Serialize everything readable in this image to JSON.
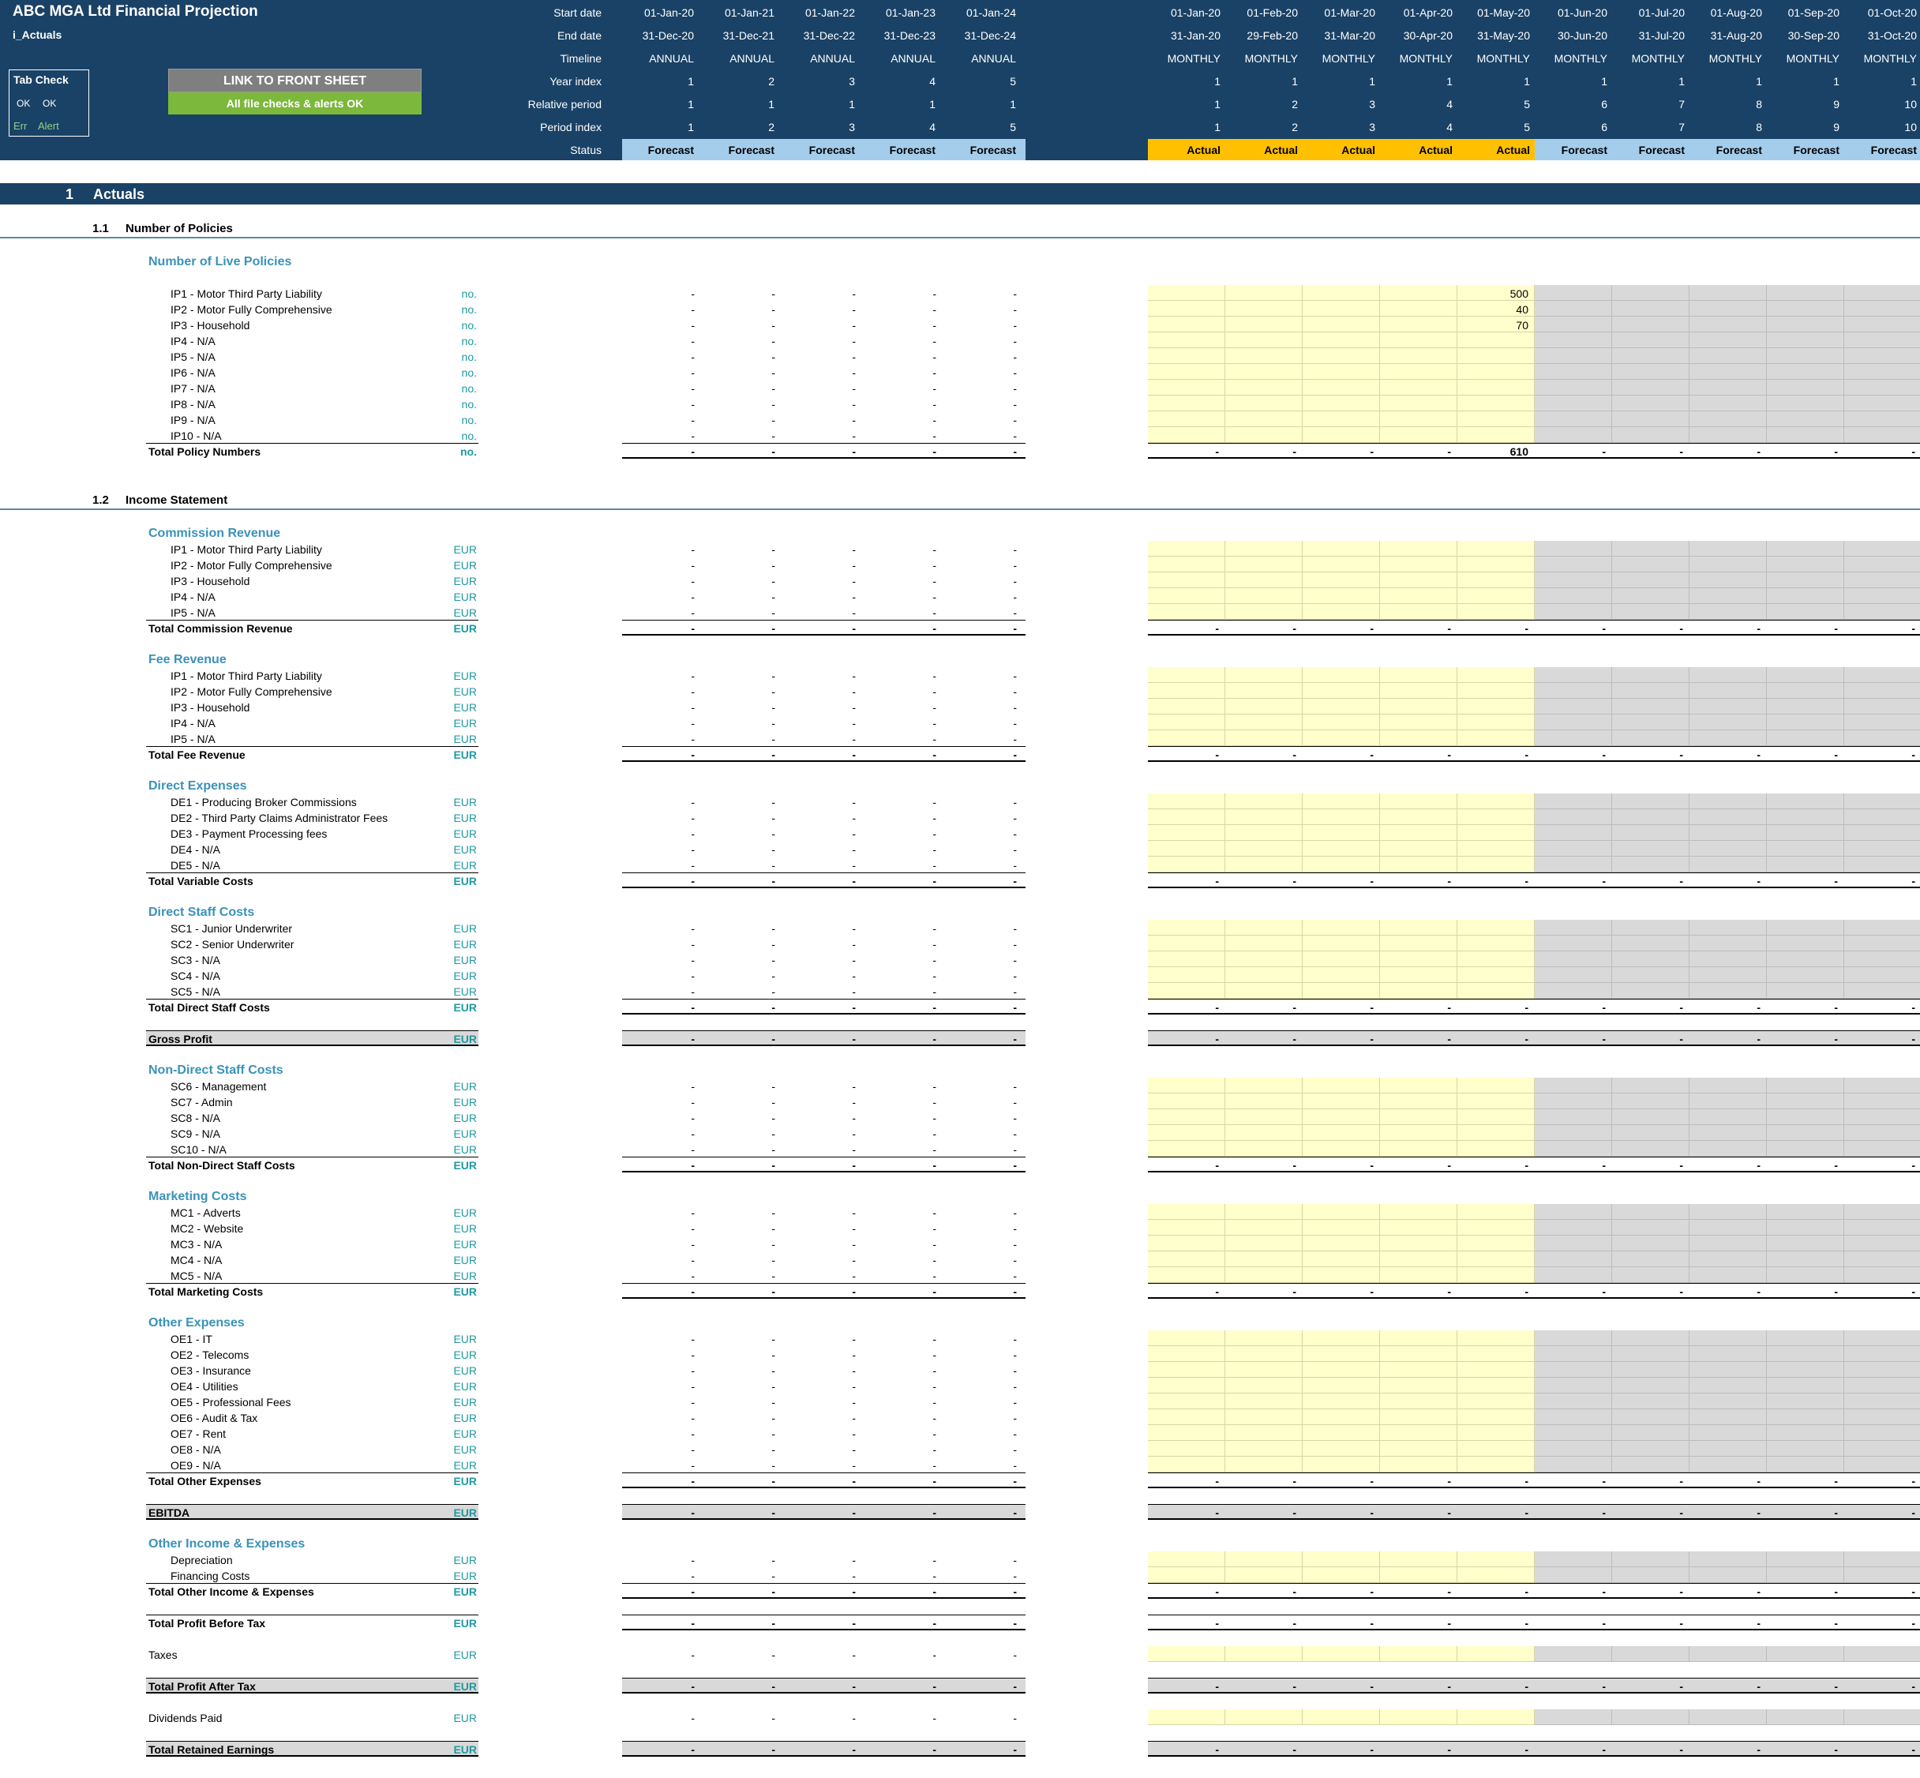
{
  "app": {
    "title": "ABC MGA Ltd Financial Projection",
    "sheet_name": "i_Actuals"
  },
  "tab_check": {
    "title": "Tab Check",
    "ok1": "OK",
    "ok2": "OK",
    "err": "Err",
    "alert": "Alert"
  },
  "buttons": {
    "link_front_sheet": "LINK TO FRONT SHEET",
    "file_checks": "All file checks & alerts OK"
  },
  "colors": {
    "header_navy": "#1a4266",
    "forecast_blue": "#a4cdec",
    "actual_orange": "#ffc000",
    "input_yellow": "#ffffcc",
    "locked_grey": "#d9d9d9",
    "teal_label": "#3a92b9",
    "unit_teal": "#1e9aa0",
    "green_button": "#7cb83b",
    "grey_button": "#7f7f7f"
  },
  "timeline": {
    "labels": [
      "Start date",
      "End date",
      "Timeline",
      "Year index",
      "Relative period",
      "Period index",
      "Status"
    ],
    "annual": {
      "start": [
        "01-Jan-20",
        "01-Jan-21",
        "01-Jan-22",
        "01-Jan-23",
        "01-Jan-24"
      ],
      "end": [
        "31-Dec-20",
        "31-Dec-21",
        "31-Dec-22",
        "31-Dec-23",
        "31-Dec-24"
      ],
      "timeline": [
        "ANNUAL",
        "ANNUAL",
        "ANNUAL",
        "ANNUAL",
        "ANNUAL"
      ],
      "year_index": [
        "1",
        "2",
        "3",
        "4",
        "5"
      ],
      "relative_period": [
        "1",
        "1",
        "1",
        "1",
        "1"
      ],
      "period_index": [
        "1",
        "2",
        "3",
        "4",
        "5"
      ],
      "status": [
        "Forecast",
        "Forecast",
        "Forecast",
        "Forecast",
        "Forecast"
      ]
    },
    "monthly": {
      "start": [
        "01-Jan-20",
        "01-Feb-20",
        "01-Mar-20",
        "01-Apr-20",
        "01-May-20",
        "01-Jun-20",
        "01-Jul-20",
        "01-Aug-20",
        "01-Sep-20",
        "01-Oct-20"
      ],
      "end": [
        "31-Jan-20",
        "29-Feb-20",
        "31-Mar-20",
        "30-Apr-20",
        "31-May-20",
        "30-Jun-20",
        "31-Jul-20",
        "31-Aug-20",
        "30-Sep-20",
        "31-Oct-20"
      ],
      "timeline": [
        "MONTHLY",
        "MONTHLY",
        "MONTHLY",
        "MONTHLY",
        "MONTHLY",
        "MONTHLY",
        "MONTHLY",
        "MONTHLY",
        "MONTHLY",
        "MONTHLY"
      ],
      "year_index": [
        "1",
        "1",
        "1",
        "1",
        "1",
        "1",
        "1",
        "1",
        "1",
        "1"
      ],
      "relative_period": [
        "1",
        "2",
        "3",
        "4",
        "5",
        "6",
        "7",
        "8",
        "9",
        "10"
      ],
      "period_index": [
        "1",
        "2",
        "3",
        "4",
        "5",
        "6",
        "7",
        "8",
        "9",
        "10"
      ],
      "status": [
        "Actual",
        "Actual",
        "Actual",
        "Actual",
        "Actual",
        "Forecast",
        "Forecast",
        "Forecast",
        "Forecast",
        "Forecast"
      ]
    }
  },
  "section": {
    "number": "1",
    "title": "Actuals"
  },
  "dash": "-",
  "blocks": [
    {
      "kind": "subsection",
      "number": "1.1",
      "title": "Number of Policies"
    },
    {
      "kind": "spacer"
    },
    {
      "kind": "group",
      "title": "Number of Live Policies"
    },
    {
      "kind": "spacer"
    },
    {
      "kind": "line",
      "label": "IP1 - Motor Third Party Liability",
      "unit": "no.",
      "monthly_values": [
        "",
        "",
        "",
        "",
        "500",
        "",
        "",
        "",
        "",
        ""
      ]
    },
    {
      "kind": "line",
      "label": "IP2 - Motor Fully Comprehensive",
      "unit": "no.",
      "monthly_values": [
        "",
        "",
        "",
        "",
        "40",
        "",
        "",
        "",
        "",
        ""
      ]
    },
    {
      "kind": "line",
      "label": "IP3 - Household",
      "unit": "no.",
      "monthly_values": [
        "",
        "",
        "",
        "",
        "70",
        "",
        "",
        "",
        "",
        ""
      ]
    },
    {
      "kind": "line",
      "label": "IP4 - N/A",
      "unit": "no."
    },
    {
      "kind": "line",
      "label": "IP5 - N/A",
      "unit": "no."
    },
    {
      "kind": "line",
      "label": "IP6 - N/A",
      "unit": "no."
    },
    {
      "kind": "line",
      "label": "IP7 - N/A",
      "unit": "no."
    },
    {
      "kind": "line",
      "label": "IP8 - N/A",
      "unit": "no."
    },
    {
      "kind": "line",
      "label": "IP9 - N/A",
      "unit": "no."
    },
    {
      "kind": "line",
      "label": "IP10 - N/A",
      "unit": "no."
    },
    {
      "kind": "total",
      "label": "Total Policy Numbers",
      "unit": "no.",
      "monthly_values": [
        "-",
        "-",
        "-",
        "-",
        "610",
        "-",
        "-",
        "-",
        "-",
        "-"
      ]
    },
    {
      "kind": "spacer"
    },
    {
      "kind": "spacer"
    },
    {
      "kind": "subsection",
      "number": "1.2",
      "title": "Income Statement"
    },
    {
      "kind": "spacer"
    },
    {
      "kind": "group",
      "title": "Commission Revenue"
    },
    {
      "kind": "line",
      "label": "IP1 - Motor Third Party Liability",
      "unit": "EUR"
    },
    {
      "kind": "line",
      "label": "IP2 - Motor Fully Comprehensive",
      "unit": "EUR"
    },
    {
      "kind": "line",
      "label": "IP3 - Household",
      "unit": "EUR"
    },
    {
      "kind": "line",
      "label": "IP4 - N/A",
      "unit": "EUR"
    },
    {
      "kind": "line",
      "label": "IP5 - N/A",
      "unit": "EUR"
    },
    {
      "kind": "total",
      "label": "Total Commission Revenue",
      "unit": "EUR"
    },
    {
      "kind": "spacer"
    },
    {
      "kind": "group",
      "title": "Fee Revenue"
    },
    {
      "kind": "line",
      "label": "IP1 - Motor Third Party Liability",
      "unit": "EUR"
    },
    {
      "kind": "line",
      "label": "IP2 - Motor Fully Comprehensive",
      "unit": "EUR"
    },
    {
      "kind": "line",
      "label": "IP3 - Household",
      "unit": "EUR"
    },
    {
      "kind": "line",
      "label": "IP4 - N/A",
      "unit": "EUR"
    },
    {
      "kind": "line",
      "label": "IP5 - N/A",
      "unit": "EUR"
    },
    {
      "kind": "total",
      "label": "Total Fee Revenue",
      "unit": "EUR"
    },
    {
      "kind": "spacer"
    },
    {
      "kind": "group",
      "title": "Direct Expenses"
    },
    {
      "kind": "line",
      "label": "DE1 - Producing Broker Commissions",
      "unit": "EUR"
    },
    {
      "kind": "line",
      "label": "DE2 - Third Party Claims Administrator Fees",
      "unit": "EUR"
    },
    {
      "kind": "line",
      "label": "DE3 - Payment Processing fees",
      "unit": "EUR"
    },
    {
      "kind": "line",
      "label": "DE4 - N/A",
      "unit": "EUR"
    },
    {
      "kind": "line",
      "label": "DE5 - N/A",
      "unit": "EUR"
    },
    {
      "kind": "total",
      "label": "Total Variable Costs",
      "unit": "EUR"
    },
    {
      "kind": "spacer"
    },
    {
      "kind": "group",
      "title": "Direct Staff Costs"
    },
    {
      "kind": "line",
      "label": "SC1 - Junior Underwriter",
      "unit": "EUR"
    },
    {
      "kind": "line",
      "label": "SC2 - Senior Underwriter",
      "unit": "EUR"
    },
    {
      "kind": "line",
      "label": "SC3 - N/A",
      "unit": "EUR"
    },
    {
      "kind": "line",
      "label": "SC4 - N/A",
      "unit": "EUR"
    },
    {
      "kind": "line",
      "label": "SC5 - N/A",
      "unit": "EUR"
    },
    {
      "kind": "total",
      "label": "Total Direct Staff Costs",
      "unit": "EUR"
    },
    {
      "kind": "spacer"
    },
    {
      "kind": "keytotal",
      "label": "Gross Profit",
      "unit": "EUR"
    },
    {
      "kind": "spacer"
    },
    {
      "kind": "group",
      "title": "Non-Direct Staff Costs"
    },
    {
      "kind": "line",
      "label": "SC6 - Management",
      "unit": "EUR"
    },
    {
      "kind": "line",
      "label": "SC7 - Admin",
      "unit": "EUR"
    },
    {
      "kind": "line",
      "label": "SC8 - N/A",
      "unit": "EUR"
    },
    {
      "kind": "line",
      "label": "SC9 - N/A",
      "unit": "EUR"
    },
    {
      "kind": "line",
      "label": "SC10 - N/A",
      "unit": "EUR"
    },
    {
      "kind": "total",
      "label": "Total Non-Direct Staff Costs",
      "unit": "EUR"
    },
    {
      "kind": "spacer"
    },
    {
      "kind": "group",
      "title": "Marketing Costs"
    },
    {
      "kind": "line",
      "label": "MC1 - Adverts",
      "unit": "EUR"
    },
    {
      "kind": "line",
      "label": "MC2 - Website",
      "unit": "EUR"
    },
    {
      "kind": "line",
      "label": "MC3 - N/A",
      "unit": "EUR"
    },
    {
      "kind": "line",
      "label": "MC4 - N/A",
      "unit": "EUR"
    },
    {
      "kind": "line",
      "label": "MC5 - N/A",
      "unit": "EUR"
    },
    {
      "kind": "total",
      "label": "Total Marketing Costs",
      "unit": "EUR"
    },
    {
      "kind": "spacer"
    },
    {
      "kind": "group",
      "title": "Other Expenses"
    },
    {
      "kind": "line",
      "label": "OE1 - IT",
      "unit": "EUR"
    },
    {
      "kind": "line",
      "label": "OE2 - Telecoms",
      "unit": "EUR"
    },
    {
      "kind": "line",
      "label": "OE3 - Insurance",
      "unit": "EUR"
    },
    {
      "kind": "line",
      "label": "OE4 - Utilities",
      "unit": "EUR"
    },
    {
      "kind": "line",
      "label": "OE5 - Professional Fees",
      "unit": "EUR"
    },
    {
      "kind": "line",
      "label": "OE6 - Audit & Tax",
      "unit": "EUR"
    },
    {
      "kind": "line",
      "label": "OE7 - Rent",
      "unit": "EUR"
    },
    {
      "kind": "line",
      "label": "OE8 - N/A",
      "unit": "EUR"
    },
    {
      "kind": "line",
      "label": "OE9 - N/A",
      "unit": "EUR"
    },
    {
      "kind": "total",
      "label": "Total Other Expenses",
      "unit": "EUR"
    },
    {
      "kind": "spacer"
    },
    {
      "kind": "keytotal",
      "label": "EBITDA",
      "unit": "EUR"
    },
    {
      "kind": "spacer"
    },
    {
      "kind": "group",
      "title": "Other Income & Expenses"
    },
    {
      "kind": "line",
      "label": "Depreciation",
      "unit": "EUR"
    },
    {
      "kind": "line",
      "label": "Financing Costs",
      "unit": "EUR"
    },
    {
      "kind": "total",
      "label": "Total Other Income & Expenses",
      "unit": "EUR"
    },
    {
      "kind": "spacer"
    },
    {
      "kind": "total",
      "label": "Total Profit Before Tax",
      "unit": "EUR"
    },
    {
      "kind": "spacer"
    },
    {
      "kind": "single",
      "label": "Taxes",
      "unit": "EUR"
    },
    {
      "kind": "spacer"
    },
    {
      "kind": "keytotal",
      "label": "Total Profit After Tax",
      "unit": "EUR"
    },
    {
      "kind": "spacer"
    },
    {
      "kind": "single",
      "label": "Dividends Paid",
      "unit": "EUR"
    },
    {
      "kind": "spacer"
    },
    {
      "kind": "keytotal",
      "label": "Total Retained Earnings",
      "unit": "EUR"
    }
  ]
}
